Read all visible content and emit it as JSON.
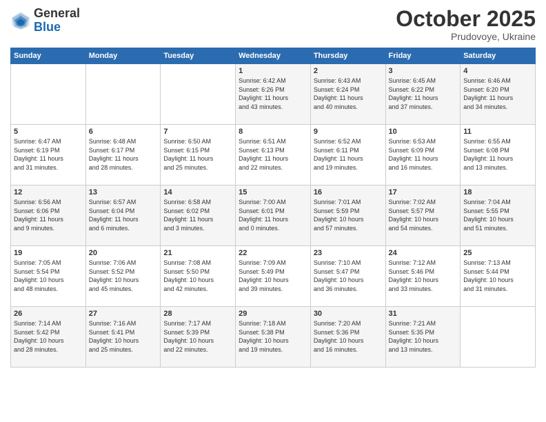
{
  "header": {
    "logo": {
      "general": "General",
      "blue": "Blue"
    },
    "title": "October 2025",
    "subtitle": "Prudovoye, Ukraine"
  },
  "weekdays": [
    "Sunday",
    "Monday",
    "Tuesday",
    "Wednesday",
    "Thursday",
    "Friday",
    "Saturday"
  ],
  "weeks": [
    [
      {
        "day": "",
        "info": ""
      },
      {
        "day": "",
        "info": ""
      },
      {
        "day": "",
        "info": ""
      },
      {
        "day": "1",
        "info": "Sunrise: 6:42 AM\nSunset: 6:26 PM\nDaylight: 11 hours\nand 43 minutes."
      },
      {
        "day": "2",
        "info": "Sunrise: 6:43 AM\nSunset: 6:24 PM\nDaylight: 11 hours\nand 40 minutes."
      },
      {
        "day": "3",
        "info": "Sunrise: 6:45 AM\nSunset: 6:22 PM\nDaylight: 11 hours\nand 37 minutes."
      },
      {
        "day": "4",
        "info": "Sunrise: 6:46 AM\nSunset: 6:20 PM\nDaylight: 11 hours\nand 34 minutes."
      }
    ],
    [
      {
        "day": "5",
        "info": "Sunrise: 6:47 AM\nSunset: 6:19 PM\nDaylight: 11 hours\nand 31 minutes."
      },
      {
        "day": "6",
        "info": "Sunrise: 6:48 AM\nSunset: 6:17 PM\nDaylight: 11 hours\nand 28 minutes."
      },
      {
        "day": "7",
        "info": "Sunrise: 6:50 AM\nSunset: 6:15 PM\nDaylight: 11 hours\nand 25 minutes."
      },
      {
        "day": "8",
        "info": "Sunrise: 6:51 AM\nSunset: 6:13 PM\nDaylight: 11 hours\nand 22 minutes."
      },
      {
        "day": "9",
        "info": "Sunrise: 6:52 AM\nSunset: 6:11 PM\nDaylight: 11 hours\nand 19 minutes."
      },
      {
        "day": "10",
        "info": "Sunrise: 6:53 AM\nSunset: 6:09 PM\nDaylight: 11 hours\nand 16 minutes."
      },
      {
        "day": "11",
        "info": "Sunrise: 6:55 AM\nSunset: 6:08 PM\nDaylight: 11 hours\nand 13 minutes."
      }
    ],
    [
      {
        "day": "12",
        "info": "Sunrise: 6:56 AM\nSunset: 6:06 PM\nDaylight: 11 hours\nand 9 minutes."
      },
      {
        "day": "13",
        "info": "Sunrise: 6:57 AM\nSunset: 6:04 PM\nDaylight: 11 hours\nand 6 minutes."
      },
      {
        "day": "14",
        "info": "Sunrise: 6:58 AM\nSunset: 6:02 PM\nDaylight: 11 hours\nand 3 minutes."
      },
      {
        "day": "15",
        "info": "Sunrise: 7:00 AM\nSunset: 6:01 PM\nDaylight: 11 hours\nand 0 minutes."
      },
      {
        "day": "16",
        "info": "Sunrise: 7:01 AM\nSunset: 5:59 PM\nDaylight: 10 hours\nand 57 minutes."
      },
      {
        "day": "17",
        "info": "Sunrise: 7:02 AM\nSunset: 5:57 PM\nDaylight: 10 hours\nand 54 minutes."
      },
      {
        "day": "18",
        "info": "Sunrise: 7:04 AM\nSunset: 5:55 PM\nDaylight: 10 hours\nand 51 minutes."
      }
    ],
    [
      {
        "day": "19",
        "info": "Sunrise: 7:05 AM\nSunset: 5:54 PM\nDaylight: 10 hours\nand 48 minutes."
      },
      {
        "day": "20",
        "info": "Sunrise: 7:06 AM\nSunset: 5:52 PM\nDaylight: 10 hours\nand 45 minutes."
      },
      {
        "day": "21",
        "info": "Sunrise: 7:08 AM\nSunset: 5:50 PM\nDaylight: 10 hours\nand 42 minutes."
      },
      {
        "day": "22",
        "info": "Sunrise: 7:09 AM\nSunset: 5:49 PM\nDaylight: 10 hours\nand 39 minutes."
      },
      {
        "day": "23",
        "info": "Sunrise: 7:10 AM\nSunset: 5:47 PM\nDaylight: 10 hours\nand 36 minutes."
      },
      {
        "day": "24",
        "info": "Sunrise: 7:12 AM\nSunset: 5:46 PM\nDaylight: 10 hours\nand 33 minutes."
      },
      {
        "day": "25",
        "info": "Sunrise: 7:13 AM\nSunset: 5:44 PM\nDaylight: 10 hours\nand 31 minutes."
      }
    ],
    [
      {
        "day": "26",
        "info": "Sunrise: 7:14 AM\nSunset: 5:42 PM\nDaylight: 10 hours\nand 28 minutes."
      },
      {
        "day": "27",
        "info": "Sunrise: 7:16 AM\nSunset: 5:41 PM\nDaylight: 10 hours\nand 25 minutes."
      },
      {
        "day": "28",
        "info": "Sunrise: 7:17 AM\nSunset: 5:39 PM\nDaylight: 10 hours\nand 22 minutes."
      },
      {
        "day": "29",
        "info": "Sunrise: 7:18 AM\nSunset: 5:38 PM\nDaylight: 10 hours\nand 19 minutes."
      },
      {
        "day": "30",
        "info": "Sunrise: 7:20 AM\nSunset: 5:36 PM\nDaylight: 10 hours\nand 16 minutes."
      },
      {
        "day": "31",
        "info": "Sunrise: 7:21 AM\nSunset: 5:35 PM\nDaylight: 10 hours\nand 13 minutes."
      },
      {
        "day": "",
        "info": ""
      }
    ]
  ]
}
